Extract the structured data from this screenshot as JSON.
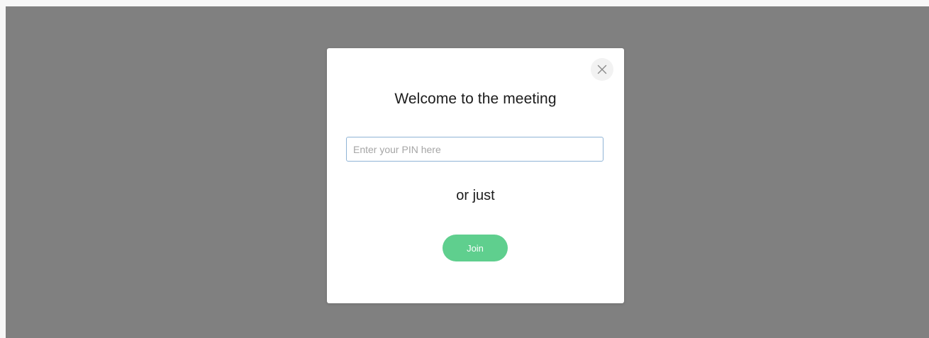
{
  "dialog": {
    "title": "Welcome to the meeting",
    "close_icon": "close-icon",
    "pin_input": {
      "value": "",
      "placeholder": "Enter your PIN here"
    },
    "separator_text": "or just",
    "join_label": "Join"
  },
  "colors": {
    "overlay": "#808080",
    "dialog_background": "#ffffff",
    "join_button": "#5fcf8e",
    "input_border_focus": "#8fb4d6",
    "close_button_background": "#f2f2f2"
  }
}
